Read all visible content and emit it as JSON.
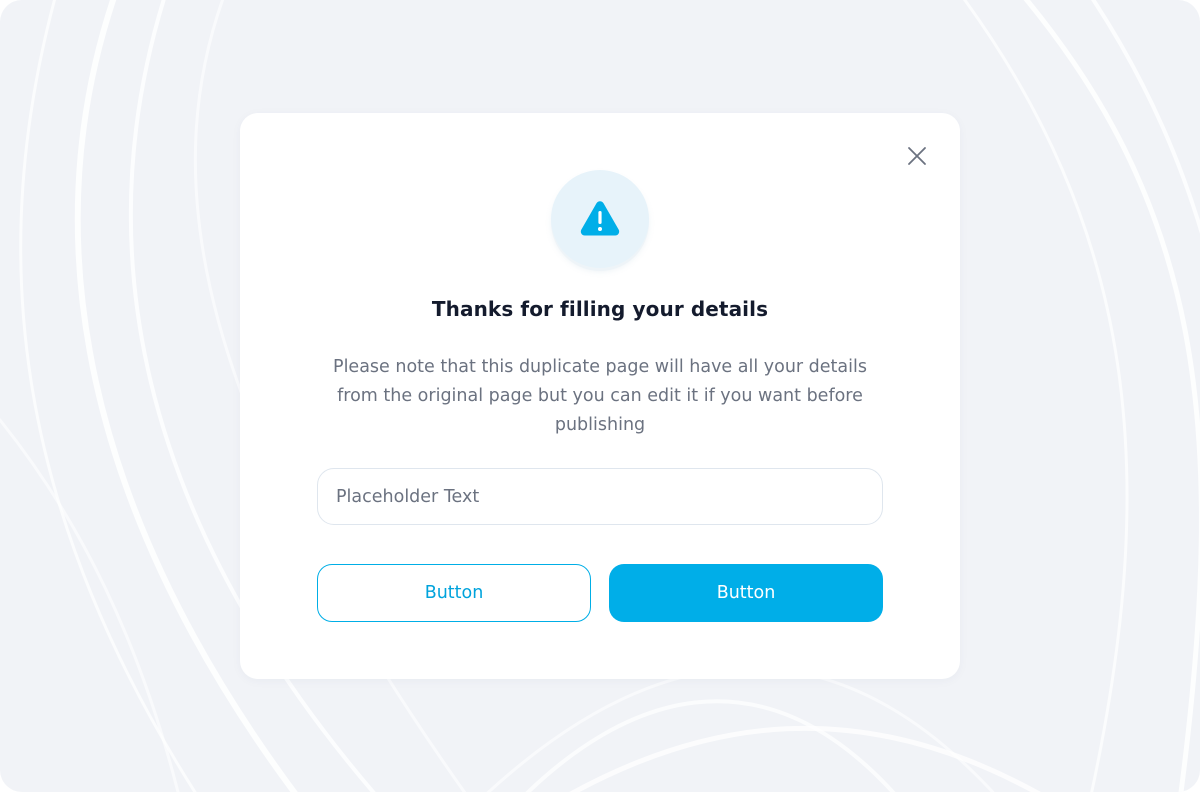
{
  "dialog": {
    "close_icon": "close-icon",
    "alert_icon": "warning-triangle-icon",
    "title": "Thanks for filling your details",
    "message": "Please note that this duplicate page will have all your details from the original page but you can edit it if you want before publishing",
    "input": {
      "placeholder": "Placeholder Text",
      "value": ""
    },
    "secondary_button_label": "Button",
    "primary_button_label": "Button"
  },
  "colors": {
    "accent": "#00aee8",
    "accent_light": "#e7f3fa",
    "title_text": "#141b2d",
    "body_text": "#6b7280",
    "background": "#f1f3f7",
    "card": "#ffffff"
  }
}
